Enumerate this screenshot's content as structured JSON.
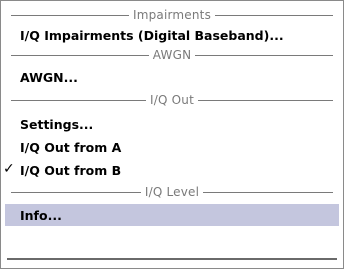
{
  "menu": {
    "groups": [
      {
        "header": "Impairments"
      },
      {
        "header": "AWGN"
      },
      {
        "header": "I/Q Out"
      },
      {
        "header": "I/Q Level"
      }
    ],
    "items": [
      {
        "label": "I/Q Impairments (Digital Baseband)..."
      },
      {
        "label": "AWGN..."
      },
      {
        "label": "Settings..."
      },
      {
        "label": "I/Q Out from A"
      },
      {
        "label": "I/Q Out from B",
        "checked": true
      },
      {
        "label": "Info...",
        "selected": true
      }
    ],
    "check_glyph": "✓"
  }
}
